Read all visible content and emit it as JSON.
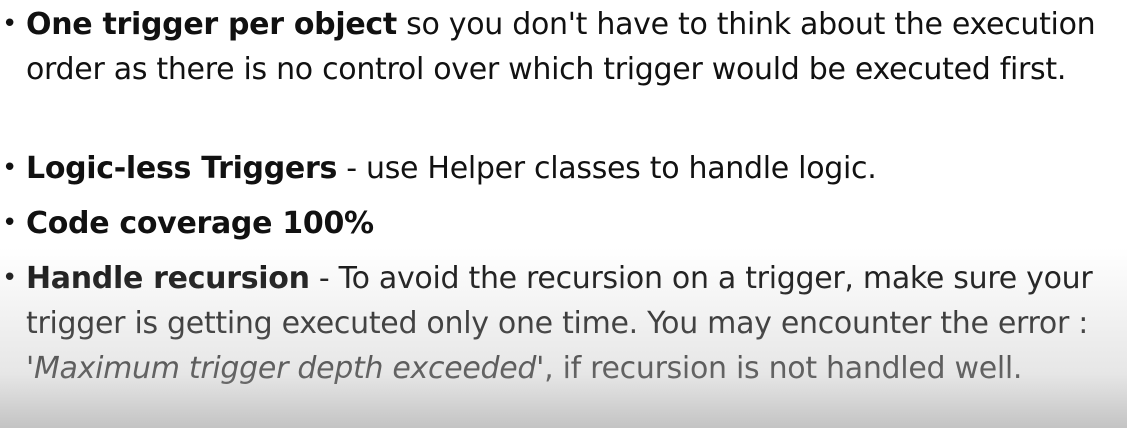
{
  "bullets": [
    {
      "lead": "One trigger per object",
      "text": " so you don't have to think about the execution order as there is no control over which trigger would be executed first."
    },
    {
      "lead": "Logic-less Triggers",
      "text": " - use Helper classes to handle logic."
    },
    {
      "lead": "Code coverage 100%",
      "text": ""
    },
    {
      "lead": "Handle recursion",
      "text_before": " - To avoid the recursion on a trigger, make sure your trigger is getting executed only one time. You may encounter the error : ",
      "italic": "'Maximum trigger depth exceeded'",
      "text_after": ", if recursion is not handled well."
    }
  ],
  "bullet_symbol": "•"
}
